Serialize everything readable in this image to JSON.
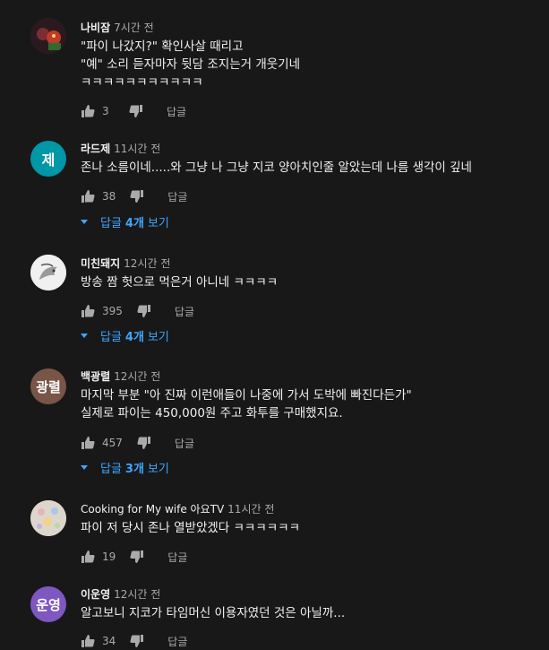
{
  "comments": [
    {
      "author": "나비잠",
      "time": "7시간 전",
      "text": "\"파이 나갔지?\" 확인사살 때리고\n\"예\" 소리 듣자마자 뒷담 조지는거 개웃기네\nㅋㅋㅋㅋㅋㅋㅋㅋㅋㅋㅋ",
      "likes": "3",
      "reply_label": "답글",
      "avatar": {
        "type": "image",
        "color": "#3a1f23"
      }
    },
    {
      "author": "라드제",
      "time": "11시간 전",
      "text": "존나 소름이네.....와 그냥 나 그냥 지코 양아치인줄 알았는데 나름 생각이 깊네",
      "likes": "38",
      "reply_label": "답글",
      "replies": {
        "prefix": "답글",
        "count": "4개",
        "suffix": "보기"
      },
      "avatar": {
        "type": "letter",
        "letter": "제",
        "color": "#0097a7"
      }
    },
    {
      "author": "미친돼지",
      "time": "12시간 전",
      "text": "방송 짬 헛으로 먹은거 아니네 ㅋㅋㅋㅋ",
      "likes": "395",
      "reply_label": "답글",
      "replies": {
        "prefix": "답글",
        "count": "4개",
        "suffix": "보기"
      },
      "avatar": {
        "type": "image",
        "color": "#e9e9e9"
      }
    },
    {
      "author": "백광렬",
      "time": "12시간 전",
      "text": "마지막 부분 \"아 진짜 이런애들이 나중에 가서 도박에 빠진다든가\"\n실제로 파이는 450,000원 주고 화투를 구매했지요.",
      "likes": "457",
      "reply_label": "답글",
      "replies": {
        "prefix": "답글",
        "count": "3개",
        "suffix": "보기"
      },
      "avatar": {
        "type": "letter",
        "letter": "광렬",
        "color": "#795548"
      }
    },
    {
      "author": "Cooking for My wife 아요TV",
      "time": "11시간 전",
      "text": "파이 저 당시 존나 열받았겠다 ㅋㅋㅋㅋㅋㅋ",
      "likes": "19",
      "reply_label": "답글",
      "avatar": {
        "type": "image",
        "color": "#d8d0c8"
      }
    },
    {
      "author": "이운영",
      "time": "12시간 전",
      "text": "알고보니 지코가 타임머신 이용자였던 것은 아닐까...",
      "likes": "34",
      "reply_label": "답글",
      "avatar": {
        "type": "letter",
        "letter": "운영",
        "color": "#7e57c2"
      }
    }
  ],
  "icons": {
    "like": "thumbs-up-icon",
    "dislike": "thumbs-down-icon",
    "expand": "caret-down-icon"
  },
  "colors": {
    "background": "#181818",
    "link": "#3ea6ff",
    "secondary": "#aaaaaa"
  }
}
